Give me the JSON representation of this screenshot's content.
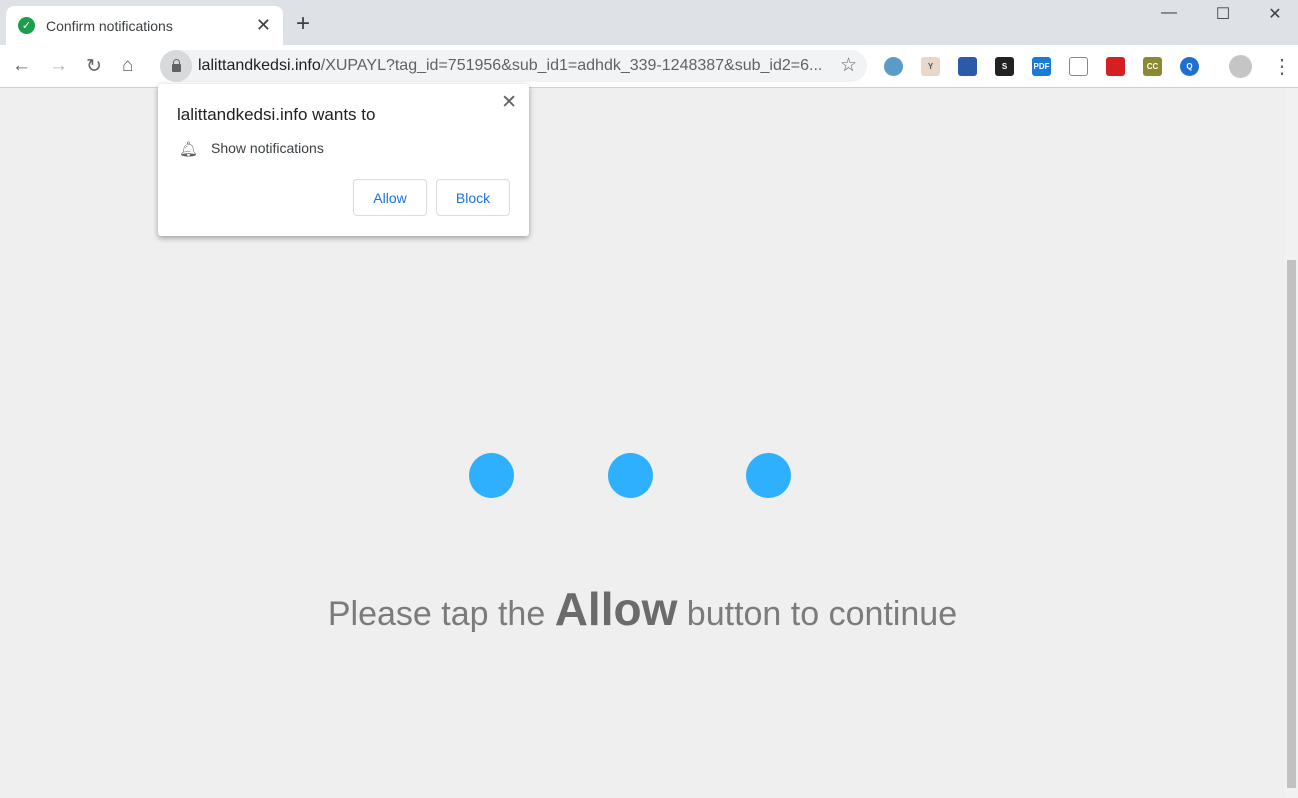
{
  "tab": {
    "title": "Confirm notifications",
    "favicon": "check-circle-icon"
  },
  "address": {
    "host": "lalittandkedsi.info",
    "path": "/XUPAYL?tag_id=751956&sub_id1=adhdk_339-1248387&sub_id2=6..."
  },
  "extensions": [
    {
      "name": "search-extension-icon",
      "color": "#5b9bc8",
      "label": ""
    },
    {
      "name": "y-extension-icon",
      "color": "#e8d8cc",
      "label": "Y"
    },
    {
      "name": "tree-extension-icon",
      "color": "#2b5aa8",
      "label": ""
    },
    {
      "name": "s-extension-icon",
      "color": "#222222",
      "label": "S"
    },
    {
      "name": "pdf-extension-icon",
      "color": "#1a7ad8",
      "label": "PDF"
    },
    {
      "name": "puzzle-extension-icon",
      "color": "#ffffff",
      "label": ""
    },
    {
      "name": "popcorn-extension-icon",
      "color": "#d42020",
      "label": ""
    },
    {
      "name": "cc-extension-icon",
      "color": "#8a8a30",
      "label": "CC"
    },
    {
      "name": "q-extension-icon",
      "color": "#1f6fd0",
      "label": "Q"
    }
  ],
  "popup": {
    "heading": "lalittandkedsi.info wants to",
    "permission": "Show notifications",
    "allow": "Allow",
    "block": "Block"
  },
  "page": {
    "msg_before": "Please tap the ",
    "msg_bold": "Allow",
    "msg_after": " button to continue",
    "dot_color": "#2fb0ff"
  }
}
